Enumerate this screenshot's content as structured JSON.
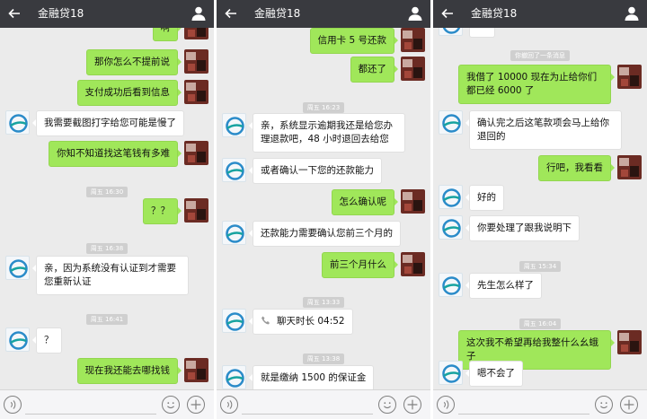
{
  "screens": [
    {
      "title": "金融贷18",
      "messages": [
        {
          "from": "me",
          "text": "啊"
        },
        {
          "from": "me",
          "text": "那你怎么不提前说"
        },
        {
          "from": "me",
          "text": "支付成功后看到信息"
        },
        {
          "from": "them",
          "text": "我需要截图打字给您可能是慢了"
        },
        {
          "from": "me",
          "text": "你知不知道找这笔钱有多难"
        },
        {
          "time": "周五 16:30"
        },
        {
          "from": "me",
          "text": "？？"
        },
        {
          "time": "周五 16:38"
        },
        {
          "from": "them",
          "text": "亲，因为系统没有认证到才需要您重新认证"
        },
        {
          "time": "周五 16:41"
        },
        {
          "from": "them",
          "text": "？"
        },
        {
          "from": "me",
          "text": "现在我还能去哪找钱"
        }
      ]
    },
    {
      "title": "金融贷18",
      "messages": [
        {
          "from": "me",
          "text": "信用卡 5 号还款"
        },
        {
          "from": "me",
          "text": "都还了"
        },
        {
          "time": "周五 16:23"
        },
        {
          "from": "them",
          "text": "亲，系统显示逾期我还是给您办理退款吧，48 小时退回去给您"
        },
        {
          "from": "them",
          "text": "或者确认一下您的还款能力"
        },
        {
          "from": "me",
          "text": "怎么确认呢"
        },
        {
          "from": "them",
          "text": "还款能力需要确认您前三个月的"
        },
        {
          "from": "me",
          "text": "前三个月什么"
        },
        {
          "time": "周五 13:33"
        },
        {
          "from": "them",
          "text": "聊天时长 04:52",
          "call": true
        },
        {
          "time": "周五 13:38"
        },
        {
          "from": "them",
          "text": "就是缴纳 1500 的保证金"
        }
      ]
    },
    {
      "title": "金融贷18",
      "messages": [
        {
          "from": "them",
          "text": "…"
        },
        {
          "time": "你撤回了一条消息"
        },
        {
          "from": "me",
          "text": "我借了 10000 现在为止给你们都已经 6000 了"
        },
        {
          "from": "them",
          "text": "确认完之后这笔款项会马上给你退回的"
        },
        {
          "from": "me",
          "text": "行吧，我看看"
        },
        {
          "from": "them",
          "text": "好的"
        },
        {
          "from": "them",
          "text": "你要处理了跟我说明下"
        },
        {
          "time": "周五 15:34"
        },
        {
          "from": "them",
          "text": "先生怎么样了"
        },
        {
          "time": "周五 16:04"
        },
        {
          "from": "me",
          "text": "这次我不希望再给我整什么幺蛾子"
        },
        {
          "from": "them",
          "text": "嗯不会了"
        }
      ]
    }
  ],
  "colors": {
    "header": "#393a3f",
    "my_bubble": "#a0e75a",
    "their_bubble": "#ffffff",
    "background": "#ebebeb"
  },
  "icons": {
    "back": "arrow-left-icon",
    "contact": "user-icon",
    "voice": "voice-icon",
    "emoji": "emoji-icon",
    "more": "plus-icon",
    "call": "phone-icon"
  }
}
